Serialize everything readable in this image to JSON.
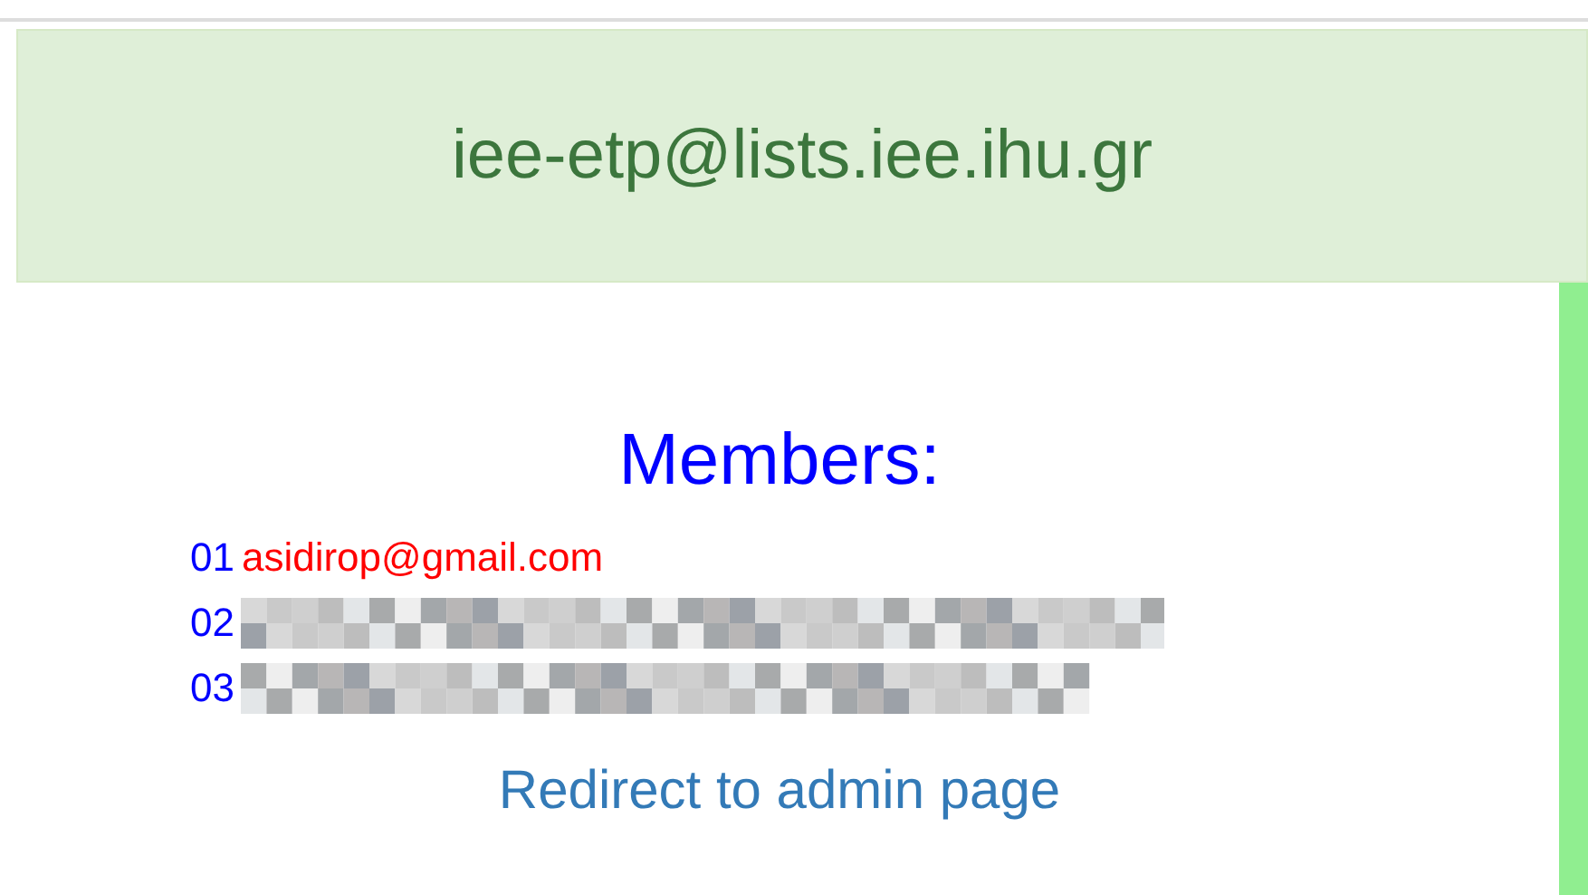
{
  "header": {
    "title": "iee-etp@lists.iee.ihu.gr"
  },
  "members_heading": "Members:",
  "members": [
    {
      "number": "01",
      "kind": "email",
      "email": "asidirop@gmail.com"
    },
    {
      "number": "02",
      "kind": "redacted"
    },
    {
      "number": "03",
      "kind": "redacted"
    }
  ],
  "admin_link": "Redirect to admin page"
}
